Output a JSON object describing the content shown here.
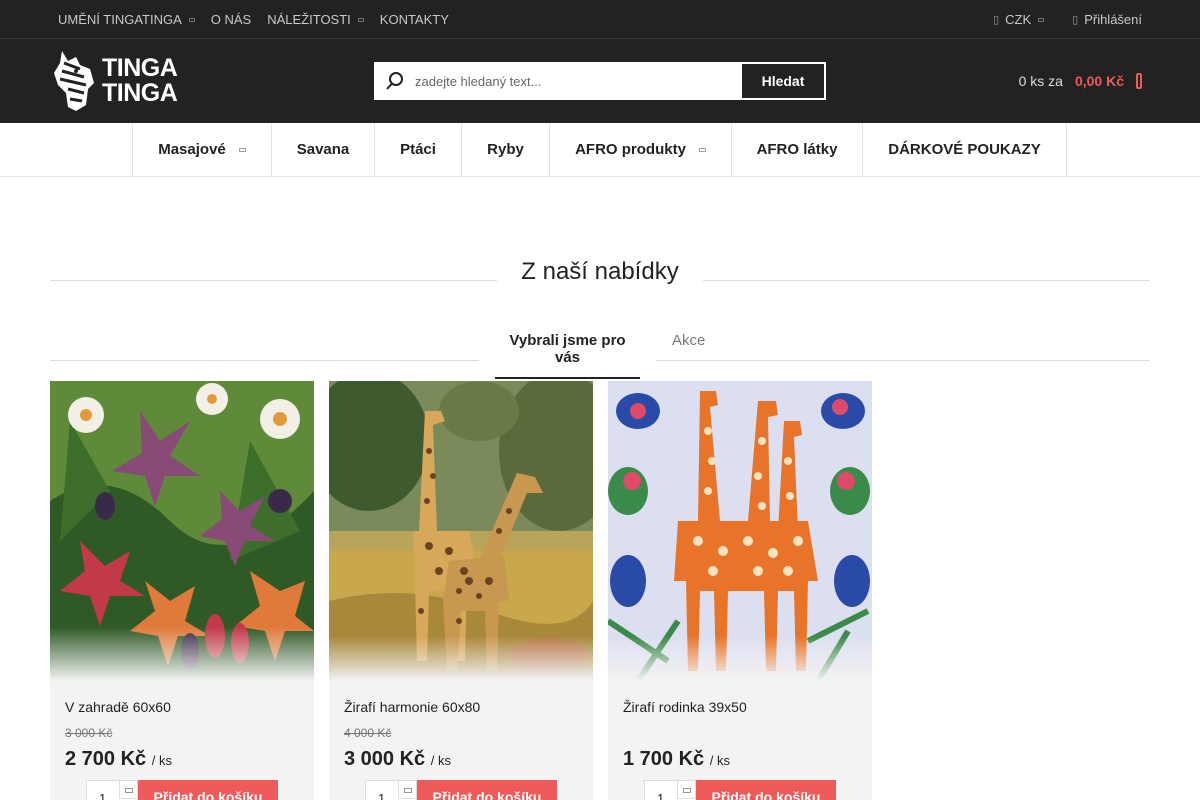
{
  "topbar": {
    "nav": [
      {
        "label": "UMĚNÍ TINGATINGA",
        "has_dropdown": true
      },
      {
        "label": "O NÁS",
        "has_dropdown": false
      },
      {
        "label": "NÁLEŽITOSTI",
        "has_dropdown": true
      },
      {
        "label": "KONTAKTY",
        "has_dropdown": false
      }
    ],
    "currency": "CZK",
    "login": "Přihlášení"
  },
  "header": {
    "logo_line1": "TINGA",
    "logo_line2": "TINGA",
    "search_placeholder": "zadejte hledaný text...",
    "search_button": "Hledat",
    "cart_count": "0 ks za",
    "cart_price": "0,00 Kč"
  },
  "categories": [
    {
      "label": "Masajové",
      "has_dropdown": true
    },
    {
      "label": "Savana",
      "has_dropdown": false
    },
    {
      "label": "Ptáci",
      "has_dropdown": false
    },
    {
      "label": "Ryby",
      "has_dropdown": false
    },
    {
      "label": "AFRO produkty",
      "has_dropdown": true
    },
    {
      "label": "AFRO látky",
      "has_dropdown": false
    },
    {
      "label": "DÁRKOVÉ POUKAZY",
      "has_dropdown": false
    }
  ],
  "section": {
    "title": "Z naší nabídky",
    "tabs": [
      "Vybrali jsme pro vás",
      "Akce"
    ]
  },
  "products": [
    {
      "name": "V zahradě 60x60",
      "old_price": "3 000 Kč",
      "price": "2 700 Kč",
      "unit": "/ ks",
      "qty": "1",
      "button": "Přidat do košíku"
    },
    {
      "name": "Žirafí harmonie 60x80",
      "old_price": "4 000 Kč",
      "price": "3 000 Kč",
      "unit": "/ ks",
      "qty": "1",
      "button": "Přidat do košíku"
    },
    {
      "name": "Žirafí rodinka 39x50",
      "old_price": "",
      "price": "1 700 Kč",
      "unit": "/ ks",
      "qty": "1",
      "button": "Přidat do košíku"
    }
  ],
  "colors": {
    "accent": "#ef5a5a",
    "dark": "#222222"
  }
}
